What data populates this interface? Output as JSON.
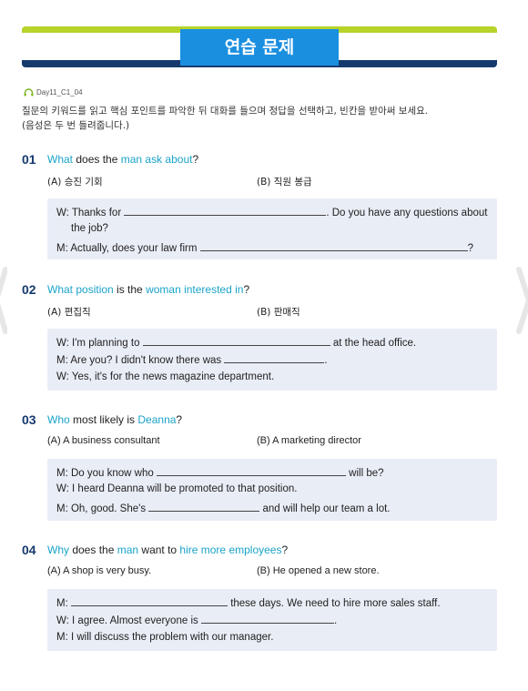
{
  "header": {
    "title": "연습 문제"
  },
  "track": {
    "label": "Day11_C1_04"
  },
  "instructions": {
    "line1": "질문의 키워드를 읽고 핵심 포인트를 파악한 뒤 대화를 들으며 정답을 선택하고, 빈칸을 받아써 보세요.",
    "line2": "(음성은 두 번 들려줍니다.)"
  },
  "questions": [
    {
      "number": "01",
      "q": [
        "What",
        " does the ",
        "man",
        " ",
        "ask about",
        "?"
      ],
      "opt_a": "(A) 승진 기회",
      "opt_b": "(B) 직원 봉급",
      "lines": {
        "l1a": "W: Thanks for",
        "l1b": ". Do you have any questions about",
        "l1c": "the job?",
        "l2a": "M: Actually, does your law firm",
        "l2b": "?"
      }
    },
    {
      "number": "02",
      "q": [
        "What position",
        " is the ",
        "woman interested in",
        "?"
      ],
      "opt_a": "(A) 편집직",
      "opt_b": "(B) 판매직",
      "lines": {
        "l1a": "W: I'm planning to",
        "l1b": "at the head office.",
        "l2a": "M: Are you? I didn't know there was",
        "l2b": ".",
        "l3": "W: Yes, it's for the news magazine department."
      }
    },
    {
      "number": "03",
      "q": [
        "Who",
        " most likely is ",
        "Deanna",
        "?"
      ],
      "opt_a": "(A) A business consultant",
      "opt_b": "(B) A marketing director",
      "lines": {
        "l1a": "M: Do you know who",
        "l1b": "will be?",
        "l2": "W: I heard Deanna will be promoted to that position.",
        "l3a": "M: Oh, good. She's",
        "l3b": "and will help our team a lot."
      }
    },
    {
      "number": "04",
      "q": [
        "Why",
        " does the ",
        "man",
        " want to ",
        "hire more employees",
        "?"
      ],
      "opt_a": "(A) A shop is very busy.",
      "opt_b": "(B) He opened a new store.",
      "lines": {
        "l1a": "M:",
        "l1b": "these days. We need to hire more sales staff.",
        "l2a": "W: I agree. Almost everyone is",
        "l2b": ".",
        "l3": "M: I will discuss the problem with our manager."
      }
    }
  ],
  "colors": {
    "accent": "#1aa3c8",
    "navy": "#173a6e",
    "lime": "#b8d32a",
    "title_bg": "#1a8fe0",
    "box_bg": "#e9edf6"
  }
}
